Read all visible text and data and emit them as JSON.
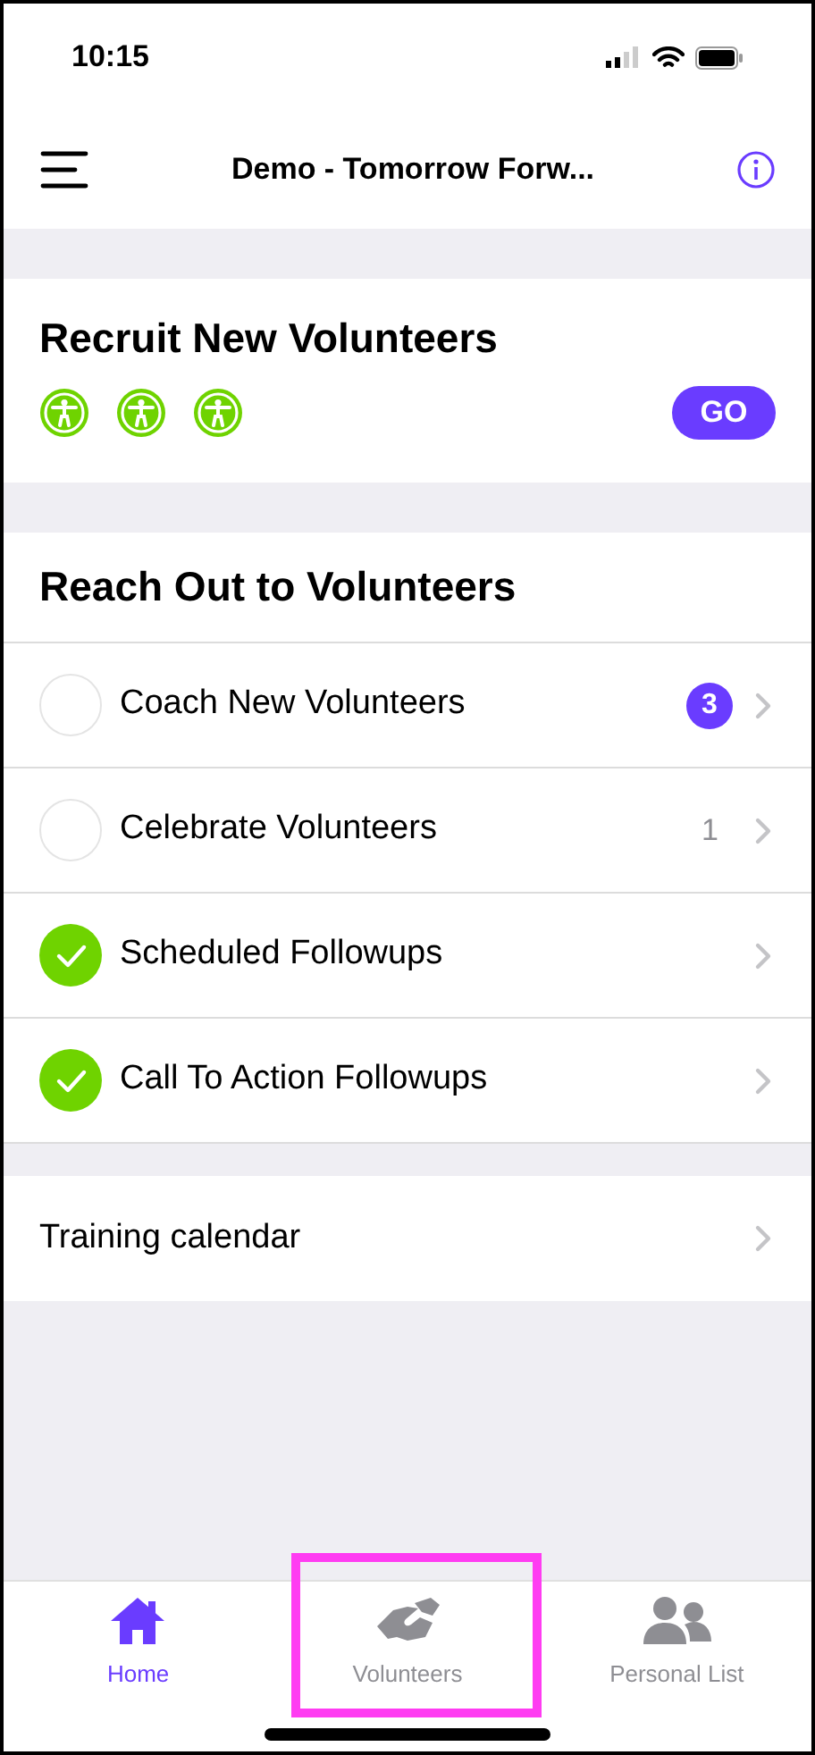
{
  "status_bar": {
    "time": "10:15"
  },
  "nav": {
    "title": "Demo - Tomorrow Forw..."
  },
  "recruit": {
    "title": "Recruit New Volunteers",
    "icon_count_items": [
      {
        "kind": "person"
      },
      {
        "kind": "person"
      },
      {
        "kind": "person"
      }
    ],
    "button": "GO"
  },
  "reach_out": {
    "title": "Reach Out to Volunteers",
    "items": [
      {
        "kind": "badge",
        "label": "Coach New Volunteers",
        "checked": false,
        "count": "3"
      },
      {
        "kind": "plain",
        "label": "Celebrate Volunteers",
        "checked": false,
        "count": "1"
      },
      {
        "label": "Scheduled Followups",
        "checked": true
      },
      {
        "label": "Call To Action Followups",
        "checked": true
      }
    ]
  },
  "links": [
    {
      "label": "Training calendar"
    }
  ],
  "tab_bar": [
    {
      "kind": "home",
      "label": "Home",
      "selected": true,
      "highlighted": false
    },
    {
      "kind": "handshake",
      "label": "Volunteers",
      "selected": false,
      "highlighted": true
    },
    {
      "kind": "people",
      "label": "Personal List",
      "selected": false,
      "highlighted": false
    }
  ]
}
